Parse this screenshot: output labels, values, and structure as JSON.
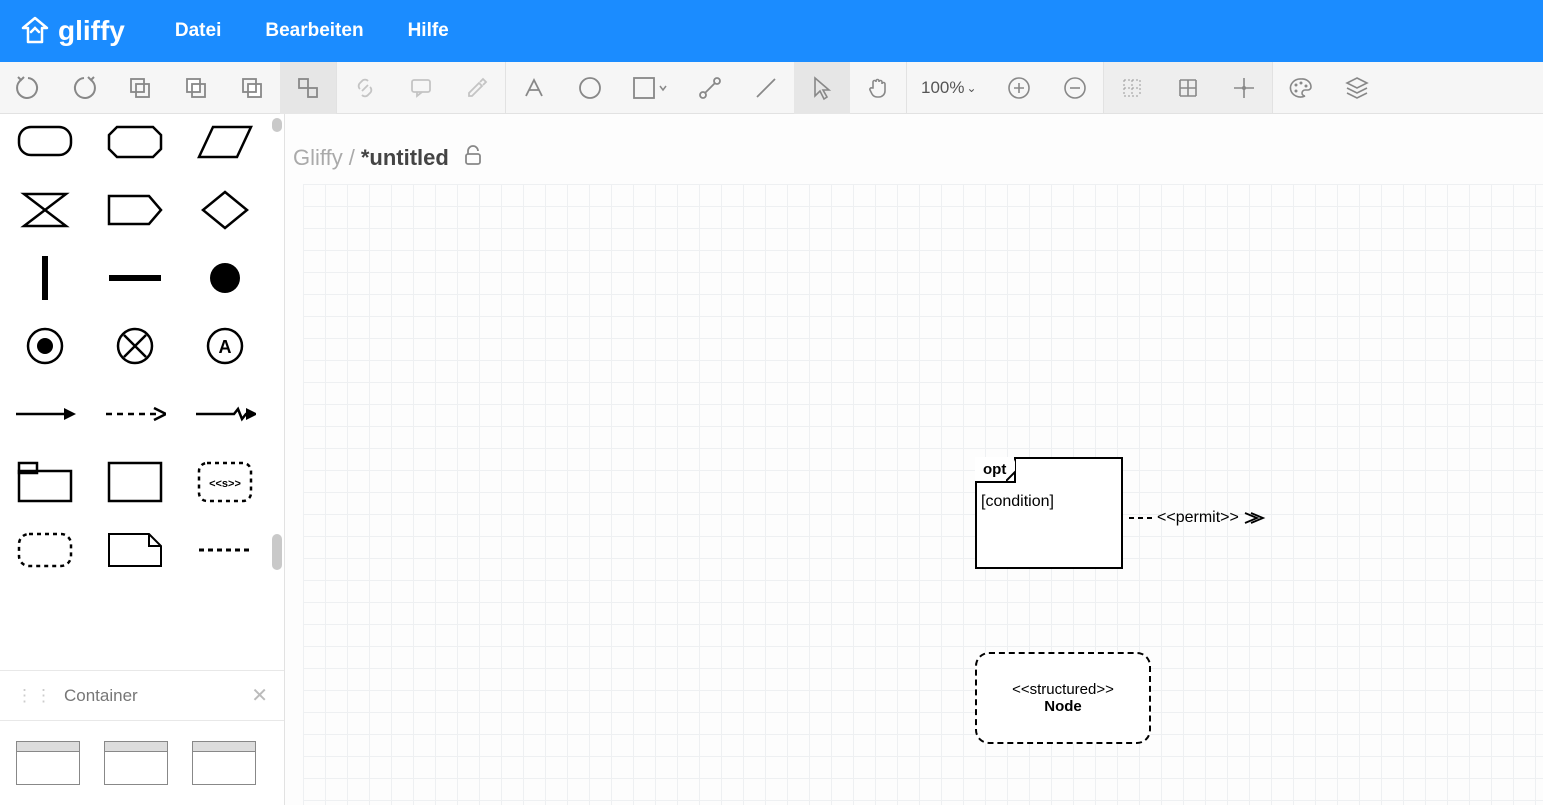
{
  "app": {
    "name": "gliffy"
  },
  "menu": {
    "file": "Datei",
    "edit": "Bearbeiten",
    "help": "Hilfe"
  },
  "toolbar": {
    "zoom": "100%"
  },
  "breadcrumb": {
    "root": "Gliffy",
    "sep": "/",
    "doc": "*untitled"
  },
  "sidebar": {
    "category": "Container"
  },
  "canvas": {
    "opt_frame": {
      "tag": "opt",
      "condition": "[condition]"
    },
    "permit_label": "<<permit>>",
    "structured_node": {
      "stereotype": "<<structured>>",
      "name": "Node"
    }
  }
}
